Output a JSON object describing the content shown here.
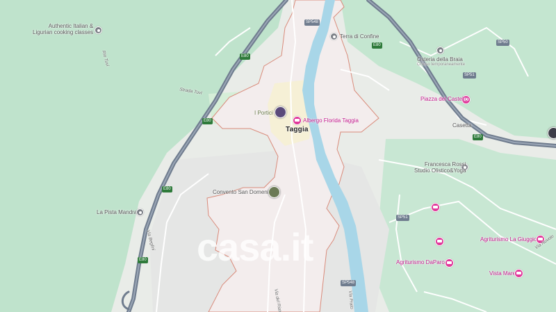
{
  "colors": {
    "forest": "#bfe3cc",
    "town_area": "#f3eded",
    "boundary": "#d98a7a",
    "river": "#a8d6e8",
    "highway": "#6f7c8e",
    "hotel": "#e0389a"
  },
  "watermark": "casa.it",
  "towns": {
    "taggia": "Taggia"
  },
  "pois": {
    "cooking": [
      "Authentic Italian &",
      "Ligurian cooking classes"
    ],
    "terra": "Terra di Confine",
    "osteria": [
      "Osteria della Braia",
      "Chiuso temporaneamente"
    ],
    "portici": "I Portici",
    "convento": "Convento San Domenico",
    "pista": "La Pista Mandracci",
    "rossi": [
      "Francesca Rossi",
      "Studio Olistico&Yoga"
    ],
    "castello": "Piazza del Castello",
    "casetta": "Casetta"
  },
  "hotels": {
    "florida": "Albergo Florida Taggia",
    "giuggiola": "Agriturismo La Giuggiola",
    "daparodi": "Agriturismo DaParodi",
    "vistamare": "Vista Mare"
  },
  "roads": {
    "sp548_a": "SP548",
    "sp548_b": "SP548",
    "sp51": "SP51",
    "sp50": "SP50",
    "sp51b": "SP51",
    "e80": "E80",
    "via_beglini": "Via Beglini",
    "strada_tuvi": "Strada Tuvi",
    "rio_tuvi": "Rio Tuvi",
    "via_nuvolo": "Via Nuvolo",
    "via_riato": "Via del Riato",
    "via_prato": "Via Prato"
  }
}
